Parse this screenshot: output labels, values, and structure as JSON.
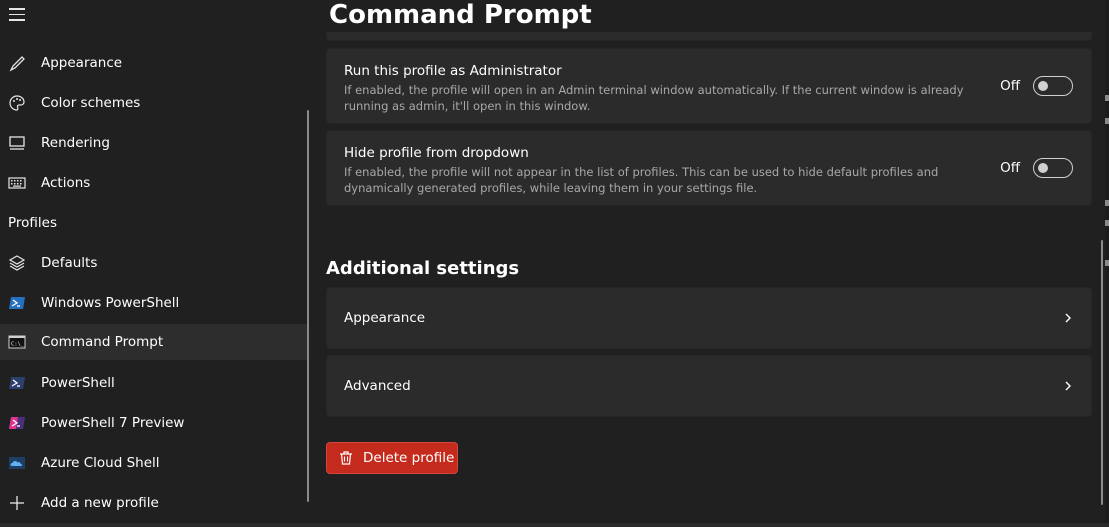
{
  "page": {
    "title": "Command Prompt"
  },
  "sidebar": {
    "items": [
      {
        "label": "Appearance",
        "icon": "paintbrush-icon"
      },
      {
        "label": "Color schemes",
        "icon": "palette-icon"
      },
      {
        "label": "Rendering",
        "icon": "monitor-icon"
      },
      {
        "label": "Actions",
        "icon": "keyboard-icon"
      }
    ],
    "profiles_header": "Profiles",
    "profiles": [
      {
        "label": "Defaults",
        "icon": "layers-icon"
      },
      {
        "label": "Windows PowerShell",
        "icon": "powershell-icon"
      },
      {
        "label": "Command Prompt",
        "icon": "cmd-icon",
        "selected": true
      },
      {
        "label": "PowerShell",
        "icon": "powershell-icon"
      },
      {
        "label": "PowerShell 7 Preview",
        "icon": "powershell-preview-icon"
      },
      {
        "label": "Azure Cloud Shell",
        "icon": "azure-cloud-icon"
      },
      {
        "label": "Add a new profile",
        "icon": "plus-icon"
      }
    ]
  },
  "settings": {
    "run_as_admin": {
      "title": "Run this profile as Administrator",
      "description": "If enabled, the profile will open in an Admin terminal window automatically. If the current window is already running as admin, it'll open in this window.",
      "state_label": "Off"
    },
    "hide_profile": {
      "title": "Hide profile from dropdown",
      "description": "If enabled, the profile will not appear in the list of profiles. This can be used to hide default profiles and dynamically generated profiles, while leaving them in your settings file.",
      "state_label": "Off"
    }
  },
  "additional": {
    "title": "Additional settings",
    "appearance_label": "Appearance",
    "advanced_label": "Advanced"
  },
  "delete_button": {
    "label": "Delete profile"
  },
  "colors": {
    "accent_red": "#c42b1c",
    "background": "#202020",
    "card": "#2b2b2b"
  }
}
